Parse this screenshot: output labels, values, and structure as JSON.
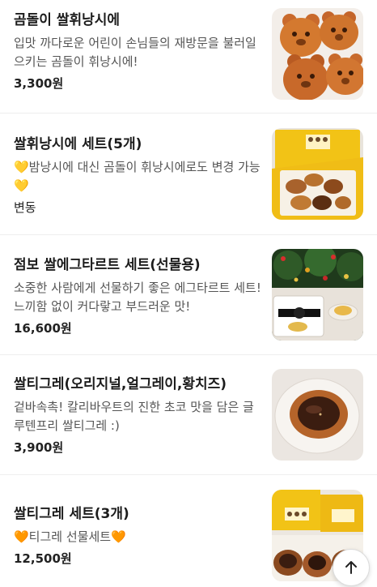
{
  "menu": [
    {
      "name": "곰돌이 쌀휘낭시에",
      "description": "입맛 까다로운 어린이 손님들의 재방문을 불러일으키는 곰돌이 휘낭시에!",
      "price": "3,300원"
    },
    {
      "name": "쌀휘낭시에 세트(5개)",
      "description": "💛밤낭시에 대신 곰돌이 휘낭시에로도 변경 가능💛",
      "price": "변동"
    },
    {
      "name": "점보 쌀에그타르트 세트(선물용)",
      "description": "소중한 사람에게 선물하기 좋은 에그타르트 세트! 느끼함 없이 커다랗고 부드러운 맛!",
      "price": "16,600원"
    },
    {
      "name": "쌀티그레(오리지널,얼그레이,황치즈)",
      "description": "겉바속촉! 칼리바우트의 진한 초코 맛을 담은 글루텐프리 쌀티그레 :)",
      "price": "3,900원"
    },
    {
      "name": "쌀티그레 세트(3개)",
      "description": "🧡티그레 선물세트🧡",
      "price": "12,500원"
    }
  ],
  "scroll_top_icon": "arrow-up-icon"
}
